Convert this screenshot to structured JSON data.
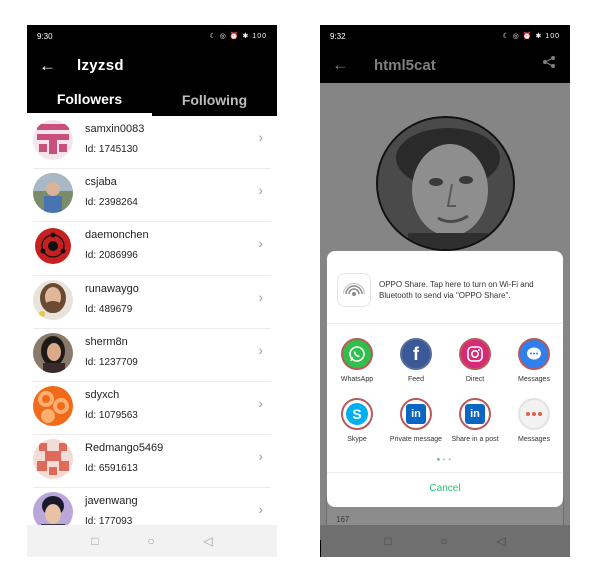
{
  "phone1": {
    "status_time": "9:30",
    "status_right": "☾ ◎ ⏰ ✱ 100",
    "title": "lzyzsd",
    "tabs": [
      {
        "label": "Followers",
        "active": true
      },
      {
        "label": "Following",
        "active": false
      }
    ],
    "users": [
      {
        "name": "samxin0083",
        "id": "Id: 1745130"
      },
      {
        "name": "csjaba",
        "id": "Id: 2398264"
      },
      {
        "name": "daemonchen",
        "id": "Id: 2086996"
      },
      {
        "name": "runawaygo",
        "id": "Id: 489679"
      },
      {
        "name": "sherm8n",
        "id": "Id: 1237709"
      },
      {
        "name": "sdyxch",
        "id": "Id: 1079563"
      },
      {
        "name": "Redmango5469",
        "id": "Id: 6591613"
      },
      {
        "name": "javenwang",
        "id": "Id: 177093"
      }
    ]
  },
  "phone2": {
    "status_time": "9:32",
    "status_right": "☾ ◎ ⏰ ✱ 100",
    "title": "html5cat",
    "oppo_share_text": "OPPO Share. Tap here to turn on Wi-Fi and Bluetooth to send via \"OPPO Share\".",
    "apps": [
      {
        "label": "WhatsApp",
        "icon": "whatsapp-icon",
        "color": "#2fbf4a"
      },
      {
        "label": "Feed",
        "icon": "facebook-icon",
        "color": "#3b5998"
      },
      {
        "label": "Direct",
        "icon": "instagram-icon",
        "color": "#d62976"
      },
      {
        "label": "Messages",
        "icon": "messenger-icon",
        "color": "#2f80ed"
      },
      {
        "label": "Skype",
        "icon": "skype-icon",
        "color": "#00aff0"
      },
      {
        "label": "Private message",
        "icon": "linkedin-icon",
        "color": "#0a66c2"
      },
      {
        "label": "Share in a post",
        "icon": "linkedin-icon",
        "color": "#0a66c2"
      },
      {
        "label": "Messages",
        "icon": "sms-icon",
        "color": "#e25c4a"
      }
    ],
    "cancel_label": "Cancel",
    "background_text": "167"
  },
  "colors": {
    "accent_green": "#2fbf71",
    "appbar": "#000000"
  }
}
